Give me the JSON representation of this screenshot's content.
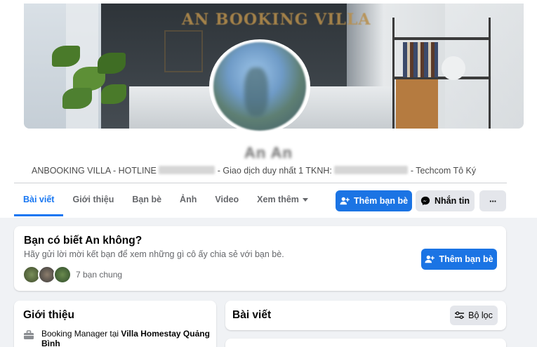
{
  "cover": {
    "sign_text": "AN BOOKING VILLA"
  },
  "profile": {
    "name": "An An",
    "bio_prefix": "ANBOOKING VILLA - HOTLINE",
    "bio_middle": "- Giao dịch duy nhất 1 TKNH:",
    "bio_suffix": "- Techcom Tô Ký"
  },
  "tabs": [
    {
      "label": "Bài viết",
      "active": true
    },
    {
      "label": "Giới thiệu"
    },
    {
      "label": "Bạn bè"
    },
    {
      "label": "Ảnh"
    },
    {
      "label": "Video"
    },
    {
      "label": "Xem thêm"
    }
  ],
  "actions": {
    "add_friend": "Thêm bạn bè",
    "message": "Nhắn tin",
    "more": "···"
  },
  "know_card": {
    "title": "Bạn có biết An không?",
    "subtitle": "Hãy gửi lời mời kết bạn để xem những gì cô ấy chia sẻ với bạn bè.",
    "mutual_label": "7 bạn chung",
    "add_friend": "Thêm bạn bè"
  },
  "intro": {
    "title": "Giới thiệu",
    "work_role": "Booking Manager tại",
    "work_place": "Villa Homestay Quảng Bình"
  },
  "posts": {
    "title": "Bài viết",
    "filter_label": "Bộ lọc"
  },
  "colors": {
    "accent": "#1b74e4",
    "background": "#f0f2f5"
  }
}
